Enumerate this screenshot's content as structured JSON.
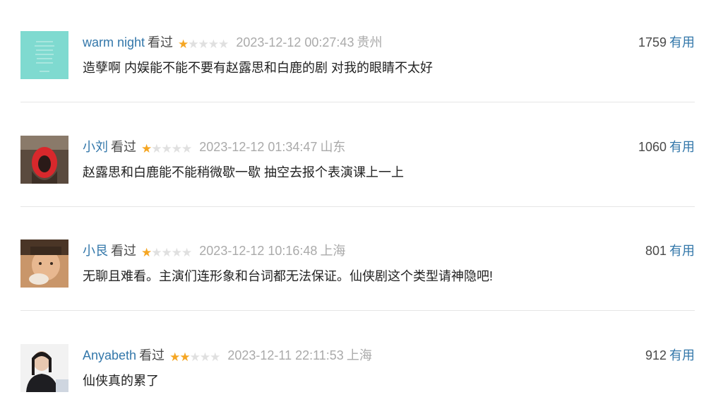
{
  "comments": [
    {
      "username": "warm night",
      "status": "看过",
      "rating": 1,
      "max_rating": 5,
      "time": "2023-12-12 00:27:43",
      "location": "贵州",
      "votes": "1759",
      "vote_label": "有用",
      "text": "造孽啊 内娱能不能不要有赵露思和白鹿的剧 对我的眼睛不太好"
    },
    {
      "username": "小刘",
      "status": "看过",
      "rating": 1,
      "max_rating": 5,
      "time": "2023-12-12 01:34:47",
      "location": "山东",
      "votes": "1060",
      "vote_label": "有用",
      "text": "赵露思和白鹿能不能稍微歇一歇 抽空去报个表演课上一上"
    },
    {
      "username": "小艮",
      "status": "看过",
      "rating": 1,
      "max_rating": 5,
      "time": "2023-12-12 10:16:48",
      "location": "上海",
      "votes": "801",
      "vote_label": "有用",
      "text": "无聊且难看。主演们连形象和台词都无法保证。仙侠剧这个类型请神隐吧!"
    },
    {
      "username": "Anyabeth",
      "status": "看过",
      "rating": 2,
      "max_rating": 5,
      "time": "2023-12-11 22:11:53",
      "location": "上海",
      "votes": "912",
      "vote_label": "有用",
      "text": "仙侠真的累了"
    }
  ],
  "colors": {
    "link": "#3377aa",
    "star_on": "#f5a623",
    "star_off": "#e0e0e0",
    "meta": "#aaaaaa"
  }
}
